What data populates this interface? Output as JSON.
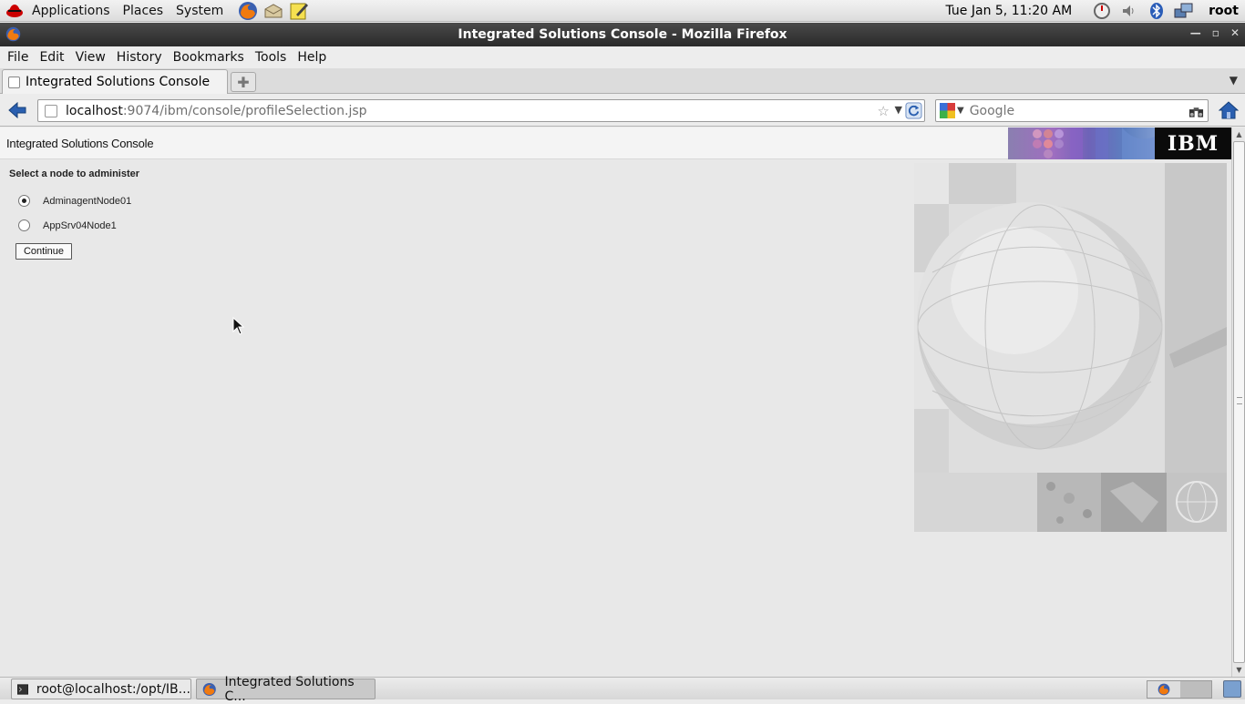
{
  "top_panel": {
    "menus": [
      "Applications",
      "Places",
      "System"
    ],
    "clock": "Tue Jan  5, 11:20 AM",
    "user": "root"
  },
  "window": {
    "title": "Integrated Solutions Console  - Mozilla Firefox"
  },
  "menubar": {
    "items": [
      "File",
      "Edit",
      "View",
      "History",
      "Bookmarks",
      "Tools",
      "Help"
    ]
  },
  "tab": {
    "label": "Integrated Solutions Console"
  },
  "urlbar": {
    "host": "localhost",
    "path": ":9074/ibm/console/profileSelection.jsp"
  },
  "search": {
    "placeholder": "Google"
  },
  "page": {
    "banner_title": "Integrated Solutions Console",
    "logo_text": "IBM",
    "prompt": "Select a node to administer",
    "nodes": [
      {
        "label": "AdminagentNode01",
        "selected": true
      },
      {
        "label": "AppSrv04Node1",
        "selected": false
      }
    ],
    "continue_label": "Continue"
  },
  "taskbar": {
    "items": [
      "root@localhost:/opt/IB...",
      "Integrated Solutions C..."
    ]
  },
  "colors": {
    "titlebar": "#333333",
    "page_bg": "#e8e8e8",
    "ibm_logo_bg": "#0b0b0b"
  }
}
